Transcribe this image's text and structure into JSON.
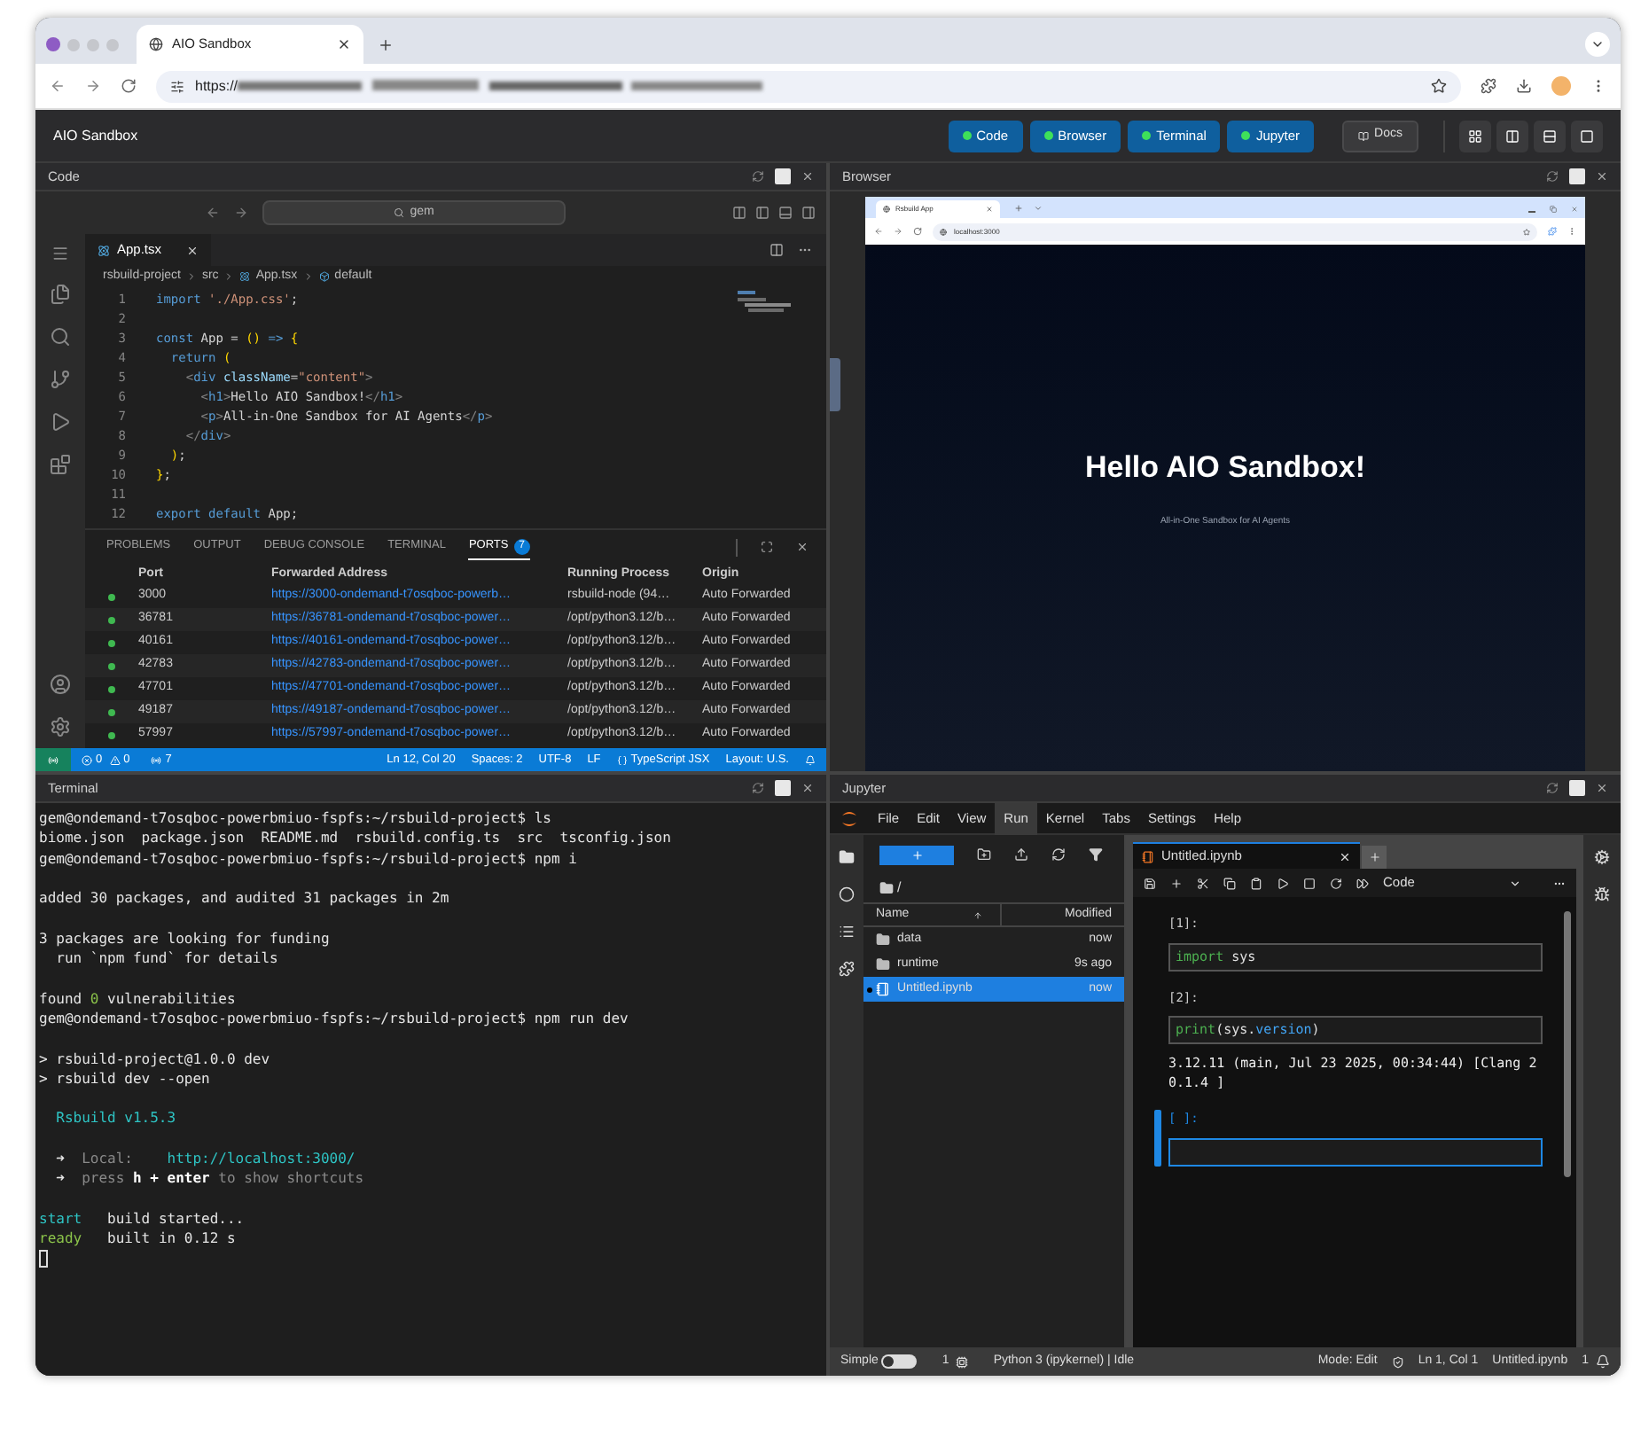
{
  "browser_window": {
    "tab_title": "AIO Sandbox",
    "url_prefix": "https://"
  },
  "app_header": {
    "title": "AIO Sandbox",
    "buttons": [
      {
        "label": "Code",
        "running": true
      },
      {
        "label": "Browser",
        "running": true
      },
      {
        "label": "Terminal",
        "running": true
      },
      {
        "label": "Jupyter",
        "running": true
      }
    ],
    "docs": "Docs"
  },
  "code_pane": {
    "title": "Code",
    "search": "gem",
    "tab": "App.tsx",
    "breadcrumbs": [
      "rsbuild-project",
      "src",
      "App.tsx",
      "default"
    ],
    "lines": [
      {
        "number": "1",
        "tokens": [
          {
            "kind": "kw",
            "text": "import "
          },
          {
            "kind": "str",
            "text": "'./App.css'"
          },
          {
            "kind": "txt",
            "text": ";"
          }
        ]
      },
      {
        "number": "2"
      },
      {
        "number": "3",
        "tokens": [
          {
            "kind": "kw",
            "text": "const"
          },
          {
            "kind": "txt",
            "text": " App = "
          },
          {
            "kind": "brk",
            "text": "()"
          },
          {
            "kind": "kw",
            "text": " => "
          },
          {
            "kind": "brk",
            "text": "{"
          }
        ]
      },
      {
        "number": "4",
        "tokens": [
          {
            "kind": "kw",
            "text": "  return "
          },
          {
            "kind": "brk",
            "text": "("
          }
        ]
      },
      {
        "number": "5",
        "tokens": [
          {
            "kind": "punct",
            "text": "    <"
          },
          {
            "kind": "tag",
            "text": "div"
          },
          {
            "kind": "attr",
            "text": " className"
          },
          {
            "kind": "txt",
            "text": "="
          },
          {
            "kind": "str",
            "text": "\"content\""
          },
          {
            "kind": "punct",
            "text": ">"
          }
        ]
      },
      {
        "number": "6",
        "tokens": [
          {
            "kind": "punct",
            "text": "      <"
          },
          {
            "kind": "tag",
            "text": "h1"
          },
          {
            "kind": "punct",
            "text": ">"
          },
          {
            "kind": "txt",
            "text": "Hello AIO Sandbox!"
          },
          {
            "kind": "punct",
            "text": "</"
          },
          {
            "kind": "tag",
            "text": "h1"
          },
          {
            "kind": "punct",
            "text": ">"
          }
        ]
      },
      {
        "number": "7",
        "tokens": [
          {
            "kind": "punct",
            "text": "      <"
          },
          {
            "kind": "tag",
            "text": "p"
          },
          {
            "kind": "punct",
            "text": ">"
          },
          {
            "kind": "txt",
            "text": "All-in-One Sandbox for AI Agents"
          },
          {
            "kind": "punct",
            "text": "</"
          },
          {
            "kind": "tag",
            "text": "p"
          },
          {
            "kind": "punct",
            "text": ">"
          }
        ]
      },
      {
        "number": "8",
        "tokens": [
          {
            "kind": "punct",
            "text": "    </"
          },
          {
            "kind": "tag",
            "text": "div"
          },
          {
            "kind": "punct",
            "text": ">"
          }
        ]
      },
      {
        "number": "9",
        "tokens": [
          {
            "kind": "brk",
            "text": "  )"
          },
          {
            "kind": "txt",
            "text": ";"
          }
        ]
      },
      {
        "number": "10",
        "tokens": [
          {
            "kind": "brk",
            "text": "}"
          },
          {
            "kind": "txt",
            "text": ";"
          }
        ]
      },
      {
        "number": "11"
      },
      {
        "number": "12",
        "tokens": [
          {
            "kind": "kw",
            "text": "export default"
          },
          {
            "kind": "txt",
            "text": " App;"
          }
        ]
      }
    ],
    "panel_tabs": [
      {
        "label": "PROBLEMS",
        "selected": false
      },
      {
        "label": "OUTPUT",
        "selected": false
      },
      {
        "label": "DEBUG CONSOLE",
        "selected": false
      },
      {
        "label": "TERMINAL",
        "selected": false
      },
      {
        "label": "PORTS",
        "selected": true,
        "badge": "7"
      }
    ],
    "ports": {
      "columns": [
        "Port",
        "Forwarded Address",
        "Running Process",
        "Origin"
      ],
      "rows": [
        {
          "port": "3000",
          "address": "https://3000-ondemand-t7osqboc-powerb…",
          "process": "rsbuild-node (94…",
          "origin": "Auto Forwarded"
        },
        {
          "port": "36781",
          "address": "https://36781-ondemand-t7osqboc-power…",
          "process": "/opt/python3.12/b…",
          "origin": "Auto Forwarded"
        },
        {
          "port": "40161",
          "address": "https://40161-ondemand-t7osqboc-power…",
          "process": "/opt/python3.12/b…",
          "origin": "Auto Forwarded"
        },
        {
          "port": "42783",
          "address": "https://42783-ondemand-t7osqboc-power…",
          "process": "/opt/python3.12/b…",
          "origin": "Auto Forwarded"
        },
        {
          "port": "47701",
          "address": "https://47701-ondemand-t7osqboc-power…",
          "process": "/opt/python3.12/b…",
          "origin": "Auto Forwarded"
        },
        {
          "port": "49187",
          "address": "https://49187-ondemand-t7osqboc-power…",
          "process": "/opt/python3.12/b…",
          "origin": "Auto Forwarded"
        },
        {
          "port": "57997",
          "address": "https://57997-ondemand-t7osqboc-power…",
          "process": "/opt/python3.12/b…",
          "origin": "Auto Forwarded"
        }
      ]
    },
    "status_bar": {
      "errors": "0",
      "warnings": "0",
      "ports": "7",
      "position": "Ln 12, Col 20",
      "spaces": "Spaces: 2",
      "encoding": "UTF-8",
      "eol": "LF",
      "language": "TypeScript JSX",
      "layout": "Layout: U.S."
    }
  },
  "browser_pane": {
    "title": "Browser",
    "tab_title": "Rsbuild App",
    "url": "localhost:3000",
    "heading": "Hello AIO Sandbox!",
    "subtitle": "All-in-One Sandbox for AI Agents"
  },
  "terminal_pane": {
    "title": "Terminal",
    "lines": [
      {
        "spaced": false,
        "segments": [
          {
            "kind": "plain",
            "text": "gem@ondemand-t7osqboc-powerbmiuo-fspfs:~/rsbuild-project$ ls"
          }
        ]
      },
      {
        "spaced": false,
        "segments": [
          {
            "kind": "plain",
            "text": "biome.json  package.json  README.md  rsbuild.config.ts  src  tsconfig.json"
          }
        ]
      },
      {
        "spaced": false,
        "segments": [
          {
            "kind": "plain",
            "text": "gem@ondemand-t7osqboc-powerbmiuo-fspfs:~/rsbuild-project$ npm i"
          }
        ]
      },
      {
        "spaced": true,
        "segments": [
          {
            "kind": "plain",
            "text": "added 30 packages, and audited 31 packages in 2m"
          }
        ]
      },
      {
        "spaced": true,
        "segments": [
          {
            "kind": "plain",
            "text": "3 packages are looking for funding"
          }
        ]
      },
      {
        "spaced": false,
        "segments": [
          {
            "kind": "plain",
            "text": "  run `npm fund` for details"
          }
        ]
      },
      {
        "spaced": true,
        "segments": [
          {
            "kind": "plain",
            "text": "found "
          },
          {
            "kind": "green",
            "text": "0"
          },
          {
            "kind": "plain",
            "text": " vulnerabilities"
          }
        ]
      },
      {
        "spaced": false,
        "segments": [
          {
            "kind": "plain",
            "text": "gem@ondemand-t7osqboc-powerbmiuo-fspfs:~/rsbuild-project$ npm run dev"
          }
        ]
      },
      {
        "spaced": true,
        "segments": [
          {
            "kind": "plain",
            "text": "> rsbuild-project@1.0.0 dev"
          }
        ]
      },
      {
        "spaced": false,
        "segments": [
          {
            "kind": "plain",
            "text": "> rsbuild dev --open"
          }
        ]
      },
      {
        "spaced": true,
        "segments": [
          {
            "kind": "cyan",
            "text": "  Rsbuild v1.5.3"
          }
        ]
      },
      {
        "spaced": true,
        "segments": [
          {
            "kind": "plain",
            "text": "  ➜  "
          },
          {
            "kind": "dim",
            "text": "Local:    "
          },
          {
            "kind": "cyan",
            "text": "http://localhost:3000/"
          }
        ]
      },
      {
        "spaced": false,
        "segments": [
          {
            "kind": "plain",
            "text": "  ➜  "
          },
          {
            "kind": "dim",
            "text": "press "
          },
          {
            "kind": "bold",
            "text": "h + enter"
          },
          {
            "kind": "dim",
            "text": " to show shortcuts"
          }
        ]
      },
      {
        "spaced": true,
        "segments": [
          {
            "kind": "cyan",
            "text": "start"
          },
          {
            "kind": "plain",
            "text": "   build started..."
          }
        ]
      },
      {
        "spaced": false,
        "segments": [
          {
            "kind": "green",
            "text": "ready"
          },
          {
            "kind": "plain",
            "text": "   built in 0.12 s"
          }
        ]
      }
    ]
  },
  "jupyter_pane": {
    "title": "Jupyter",
    "menu": [
      {
        "label": "File",
        "selected": false
      },
      {
        "label": "Edit",
        "selected": false
      },
      {
        "label": "View",
        "selected": false
      },
      {
        "label": "Run",
        "selected": true
      },
      {
        "label": "Kernel",
        "selected": false
      },
      {
        "label": "Tabs",
        "selected": false
      },
      {
        "label": "Settings",
        "selected": false
      },
      {
        "label": "Help",
        "selected": false
      }
    ],
    "path": "/",
    "file_columns": [
      "Name",
      "Modified"
    ],
    "files": [
      {
        "name": "data",
        "modified": "now",
        "kind": "folder",
        "selected": false,
        "running": false
      },
      {
        "name": "runtime",
        "modified": "9s ago",
        "kind": "folder",
        "selected": false,
        "running": false
      },
      {
        "name": "Untitled.ipynb",
        "modified": "now",
        "kind": "notebook",
        "selected": true,
        "running": true
      }
    ],
    "notebook_tab": "Untitled.ipynb",
    "cell_type": "Code",
    "cells": [
      {
        "prompt": "[1]:",
        "active": false,
        "tokens": [
          {
            "kind": "kw",
            "text": "import"
          },
          {
            "kind": "txt",
            "text": " sys"
          }
        ]
      },
      {
        "prompt": "[2]:",
        "active": false,
        "tokens": [
          {
            "kind": "kw",
            "text": "print"
          },
          {
            "kind": "txt",
            "text": "(sys."
          },
          {
            "kind": "attr",
            "text": "version"
          },
          {
            "kind": "txt",
            "text": ")"
          }
        ],
        "output": "3.12.11 (main, Jul 23 2025, 00:34:44) [Clang 20.1.4 ]"
      },
      {
        "prompt": "[ ]:",
        "active": true
      }
    ],
    "status_bar": {
      "mode_label": "Simple",
      "simple_mode": false,
      "kernels": "1",
      "kernel": "Python 3 (ipykernel) | Idle",
      "mode": "Mode: Edit",
      "position": "Ln 1, Col 1",
      "file": "Untitled.ipynb",
      "notifications": "1"
    }
  }
}
